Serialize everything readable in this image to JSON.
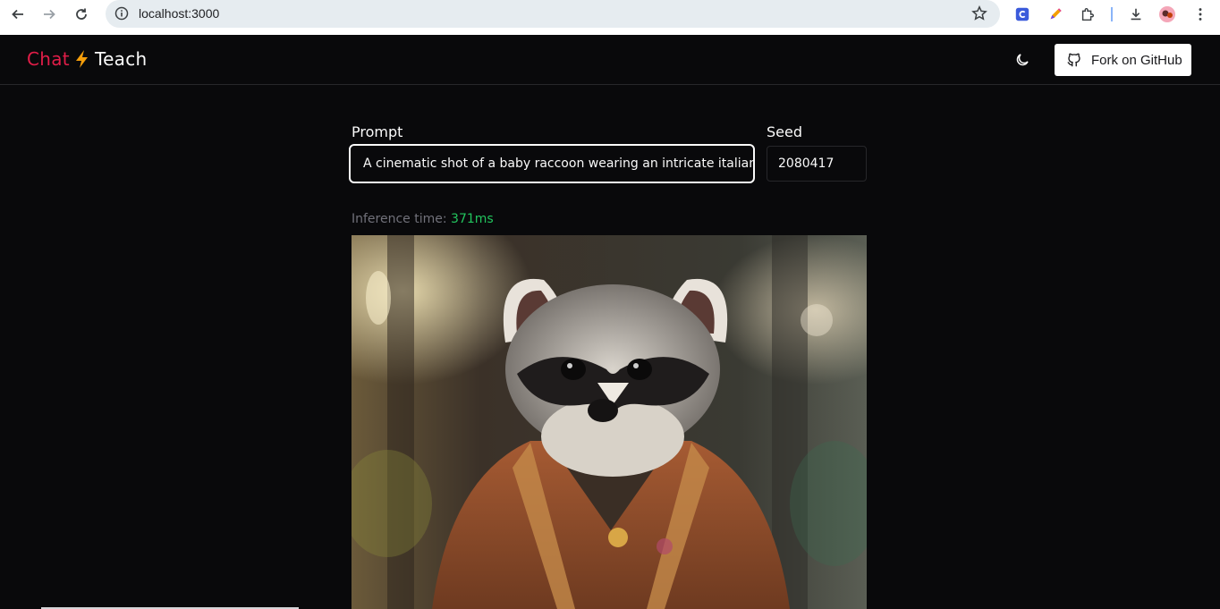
{
  "browser": {
    "url": "localhost:3000"
  },
  "header": {
    "brand_part1": "Chat",
    "brand_part2": "Teach",
    "github_button": "Fork on GitHub"
  },
  "form": {
    "prompt_label": "Prompt",
    "prompt_value": "A cinematic shot of a baby raccoon wearing an intricate italian pr",
    "seed_label": "Seed",
    "seed_value": "2080417"
  },
  "inference": {
    "label": "Inference time:",
    "value": "371ms"
  },
  "colors": {
    "brand_red": "#e11d48",
    "bolt": "#f59e0b",
    "success_green": "#22c55e",
    "background": "#09090b"
  }
}
